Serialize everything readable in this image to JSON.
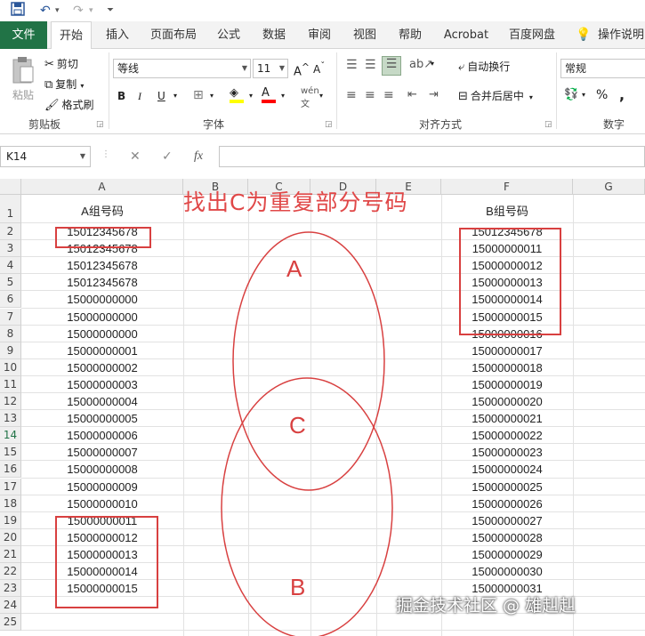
{
  "toolbar": {
    "save_icon": "save-icon",
    "undo_icon": "undo-icon",
    "redo_icon": "redo-icon",
    "customize_icon": "customize-icon"
  },
  "tabs": [
    {
      "label": "文件"
    },
    {
      "label": "开始"
    },
    {
      "label": "插入"
    },
    {
      "label": "页面布局"
    },
    {
      "label": "公式"
    },
    {
      "label": "数据"
    },
    {
      "label": "审阅"
    },
    {
      "label": "视图"
    },
    {
      "label": "帮助"
    },
    {
      "label": "Acrobat"
    },
    {
      "label": "百度网盘"
    },
    {
      "label": "操作说明"
    }
  ],
  "ribbon": {
    "clipboard": {
      "paste": "粘贴",
      "cut": "剪切",
      "copy": "复制",
      "format_painter": "格式刷",
      "group_label": "剪贴板"
    },
    "font": {
      "font_name": "等线",
      "font_size": "11",
      "bold": "B",
      "italic": "I",
      "underline": "U",
      "group_label": "字体",
      "fill_color": "#ffff00",
      "font_color": "#ff0000"
    },
    "alignment": {
      "wrap_text": "自动换行",
      "merge_center": "合并后居中",
      "group_label": "对齐方式"
    },
    "number": {
      "format": "常规",
      "percent": "%",
      "comma": ",",
      "group_label": "数字"
    }
  },
  "formula_bar": {
    "name_box": "K14",
    "formula": ""
  },
  "sheet": {
    "columns": [
      "A",
      "B",
      "C",
      "D",
      "E",
      "F",
      "G"
    ],
    "rows": [
      "1",
      "2",
      "3",
      "4",
      "5",
      "6",
      "7",
      "8",
      "9",
      "10",
      "11",
      "12",
      "13",
      "14",
      "15",
      "16",
      "17",
      "18",
      "19",
      "20",
      "21",
      "22",
      "23",
      "24",
      "25"
    ],
    "selected_row": "14",
    "header_a": "A组号码",
    "header_f": "B组号码",
    "col_a": [
      "15012345678",
      "15012345678",
      "15012345678",
      "15012345678",
      "15000000000",
      "15000000000",
      "15000000000",
      "15000000001",
      "15000000002",
      "15000000003",
      "15000000004",
      "15000000005",
      "15000000006",
      "15000000007",
      "15000000008",
      "15000000009",
      "15000000010",
      "15000000011",
      "15000000012",
      "15000000013",
      "15000000014",
      "15000000015"
    ],
    "col_f": [
      "15012345678",
      "15000000011",
      "15000000012",
      "15000000013",
      "15000000014",
      "15000000015",
      "15000000016",
      "15000000017",
      "15000000018",
      "15000000019",
      "15000000020",
      "15000000021",
      "15000000022",
      "15000000023",
      "15000000024",
      "15000000025",
      "15000000026",
      "15000000027",
      "15000000028",
      "15000000029",
      "15000000030",
      "15000000031"
    ]
  },
  "annotations": {
    "title": "找出C为重复部分号码",
    "label_a": "A",
    "label_b": "B",
    "label_c": "C",
    "color": "#d84040"
  },
  "watermark": "掘金技术社区 @ 雄赳赳"
}
